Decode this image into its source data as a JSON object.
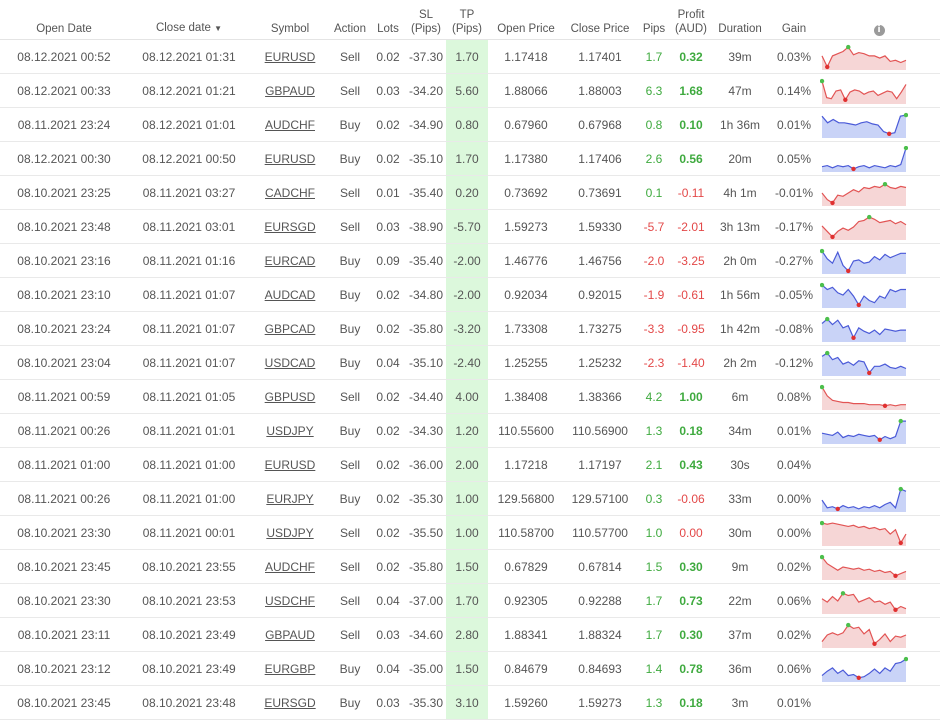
{
  "headers": {
    "open_date": "Open Date",
    "close_date": "Close date",
    "sort_arrow": "▼",
    "symbol": "Symbol",
    "action": "Action",
    "lots": "Lots",
    "sl_1": "SL",
    "sl_2": "(Pips)",
    "tp_1": "TP",
    "tp_2": "(Pips)",
    "open_price": "Open Price",
    "close_price": "Close Price",
    "pips": "Pips",
    "profit_1": "Profit",
    "profit_2": "(AUD)",
    "duration": "Duration",
    "gain": "Gain",
    "info_icon": "info-icon"
  },
  "colors": {
    "positive": "#3faa3f",
    "negative": "#e34848",
    "tp_bg": "#dcf8dc",
    "buy_line": "#4a5ad8",
    "buy_fill": "#c9d3f7",
    "sell_line": "#e25454",
    "sell_fill": "#f6d6d6"
  },
  "trades": [
    {
      "open": "08.12.2021 00:52",
      "close": "08.12.2021 01:31",
      "symbol": "EURUSD",
      "action": "Sell",
      "lots": "0.02",
      "sl": "-37.30",
      "tp": "1.70",
      "open_price": "1.17418",
      "close_price": "1.17401",
      "pips": "1.7",
      "profit": "0.32",
      "duration": "39m",
      "gain": "0.03%",
      "spark": [
        0.55,
        0.05,
        0.55,
        0.65,
        0.75,
        0.95,
        0.6,
        0.7,
        0.65,
        0.55,
        0.55,
        0.45,
        0.55,
        0.3,
        0.35,
        0.25,
        0.35
      ]
    },
    {
      "open": "08.12.2021 00:33",
      "close": "08.12.2021 01:21",
      "symbol": "GBPAUD",
      "action": "Sell",
      "lots": "0.03",
      "sl": "-34.20",
      "tp": "5.60",
      "open_price": "1.88066",
      "close_price": "1.88003",
      "pips": "6.3",
      "profit": "1.68",
      "duration": "47m",
      "gain": "0.14%",
      "spark": [
        0.95,
        0.2,
        0.15,
        0.5,
        0.55,
        0.1,
        0.45,
        0.55,
        0.5,
        0.35,
        0.45,
        0.5,
        0.3,
        0.4,
        0.5,
        0.45,
        0.15,
        0.45,
        0.8
      ]
    },
    {
      "open": "08.11.2021 23:24",
      "close": "08.12.2021 01:01",
      "symbol": "AUDCHF",
      "action": "Buy",
      "lots": "0.02",
      "sl": "-34.90",
      "tp": "0.80",
      "open_price": "0.67960",
      "close_price": "0.67968",
      "pips": "0.8",
      "profit": "0.10",
      "duration": "1h 36m",
      "gain": "0.01%",
      "spark": [
        0.9,
        0.6,
        0.75,
        0.6,
        0.6,
        0.55,
        0.5,
        0.6,
        0.65,
        0.55,
        0.5,
        0.2,
        0.1,
        0.15,
        0.9,
        0.95
      ]
    },
    {
      "open": "08.12.2021 00:30",
      "close": "08.12.2021 00:50",
      "symbol": "EURUSD",
      "action": "Buy",
      "lots": "0.02",
      "sl": "-35.10",
      "tp": "1.70",
      "open_price": "1.17380",
      "close_price": "1.17406",
      "pips": "2.6",
      "profit": "0.56",
      "duration": "20m",
      "gain": "0.05%",
      "spark": [
        0.15,
        0.2,
        0.1,
        0.2,
        0.15,
        0.2,
        0.05,
        0.15,
        0.2,
        0.1,
        0.2,
        0.15,
        0.1,
        0.2,
        0.15,
        0.25,
        1.0
      ]
    },
    {
      "open": "08.10.2021 23:25",
      "close": "08.11.2021 03:27",
      "symbol": "CADCHF",
      "action": "Sell",
      "lots": "0.01",
      "sl": "-35.40",
      "tp": "0.20",
      "open_price": "0.73692",
      "close_price": "0.73691",
      "pips": "0.1",
      "profit": "-0.11",
      "duration": "4h 1m",
      "gain": "-0.01%",
      "spark": [
        0.5,
        0.2,
        0.05,
        0.4,
        0.35,
        0.5,
        0.65,
        0.55,
        0.75,
        0.7,
        0.8,
        0.75,
        0.9,
        0.75,
        0.7,
        0.8,
        0.75
      ]
    },
    {
      "open": "08.10.2021 23:48",
      "close": "08.11.2021 03:01",
      "symbol": "EURSGD",
      "action": "Sell",
      "lots": "0.03",
      "sl": "-38.90",
      "tp": "-5.70",
      "open_price": "1.59273",
      "close_price": "1.59330",
      "pips": "-5.7",
      "profit": "-2.01",
      "duration": "3h 13m",
      "gain": "-0.17%",
      "spark": [
        0.55,
        0.3,
        0.05,
        0.3,
        0.45,
        0.35,
        0.5,
        0.75,
        0.8,
        0.95,
        0.85,
        0.7,
        0.75,
        0.8,
        0.65,
        0.75,
        0.6
      ]
    },
    {
      "open": "08.10.2021 23:16",
      "close": "08.11.2021 01:16",
      "symbol": "EURCAD",
      "action": "Buy",
      "lots": "0.09",
      "sl": "-35.40",
      "tp": "-2.00",
      "open_price": "1.46776",
      "close_price": "1.46756",
      "pips": "-2.0",
      "profit": "-3.25",
      "duration": "2h 0m",
      "gain": "-0.27%",
      "spark": [
        0.95,
        0.6,
        0.4,
        0.9,
        0.3,
        0.05,
        0.5,
        0.55,
        0.4,
        0.45,
        0.7,
        0.55,
        0.8,
        0.65,
        0.75,
        0.85,
        0.85
      ]
    },
    {
      "open": "08.10.2021 23:10",
      "close": "08.11.2021 01:07",
      "symbol": "AUDCAD",
      "action": "Buy",
      "lots": "0.02",
      "sl": "-34.80",
      "tp": "-2.00",
      "open_price": "0.92034",
      "close_price": "0.92015",
      "pips": "-1.9",
      "profit": "-0.61",
      "duration": "1h 56m",
      "gain": "-0.05%",
      "spark": [
        0.95,
        0.75,
        0.85,
        0.6,
        0.5,
        0.75,
        0.45,
        0.05,
        0.45,
        0.25,
        0.15,
        0.45,
        0.35,
        0.75,
        0.65,
        0.75,
        0.75
      ]
    },
    {
      "open": "08.10.2021 23:24",
      "close": "08.11.2021 01:07",
      "symbol": "GBPCAD",
      "action": "Buy",
      "lots": "0.02",
      "sl": "-35.80",
      "tp": "-3.20",
      "open_price": "1.73308",
      "close_price": "1.73275",
      "pips": "-3.3",
      "profit": "-0.95",
      "duration": "1h 42m",
      "gain": "-0.08%",
      "spark": [
        0.75,
        0.95,
        0.7,
        0.9,
        0.55,
        0.65,
        0.1,
        0.55,
        0.4,
        0.3,
        0.45,
        0.25,
        0.5,
        0.45,
        0.4,
        0.45,
        0.45
      ]
    },
    {
      "open": "08.10.2021 23:04",
      "close": "08.11.2021 01:07",
      "symbol": "USDCAD",
      "action": "Buy",
      "lots": "0.04",
      "sl": "-35.10",
      "tp": "-2.40",
      "open_price": "1.25255",
      "close_price": "1.25232",
      "pips": "-2.3",
      "profit": "-1.40",
      "duration": "2h 2m",
      "gain": "-0.12%",
      "spark": [
        0.8,
        0.95,
        0.65,
        0.75,
        0.45,
        0.55,
        0.4,
        0.6,
        0.55,
        0.05,
        0.35,
        0.35,
        0.45,
        0.3,
        0.25,
        0.35,
        0.25
      ]
    },
    {
      "open": "08.11.2021 00:59",
      "close": "08.11.2021 01:05",
      "symbol": "GBPUSD",
      "action": "Sell",
      "lots": "0.02",
      "sl": "-34.40",
      "tp": "4.00",
      "open_price": "1.38408",
      "close_price": "1.38366",
      "pips": "4.2",
      "profit": "1.00",
      "duration": "6m",
      "gain": "0.08%",
      "spark": [
        0.95,
        0.55,
        0.35,
        0.3,
        0.25,
        0.25,
        0.2,
        0.2,
        0.2,
        0.15,
        0.15,
        0.15,
        0.1,
        0.15,
        0.1,
        0.15,
        0.15
      ]
    },
    {
      "open": "08.11.2021 00:26",
      "close": "08.11.2021 01:01",
      "symbol": "USDJPY",
      "action": "Buy",
      "lots": "0.02",
      "sl": "-34.30",
      "tp": "1.20",
      "open_price": "110.55600",
      "close_price": "110.56900",
      "pips": "1.3",
      "profit": "0.18",
      "duration": "34m",
      "gain": "0.01%",
      "spark": [
        0.4,
        0.35,
        0.3,
        0.45,
        0.2,
        0.3,
        0.25,
        0.35,
        0.3,
        0.25,
        0.3,
        0.1,
        0.25,
        0.15,
        0.25,
        0.95,
        0.95
      ]
    },
    {
      "open": "08.11.2021 01:00",
      "close": "08.11.2021 01:00",
      "symbol": "EURUSD",
      "action": "Sell",
      "lots": "0.02",
      "sl": "-36.00",
      "tp": "2.00",
      "open_price": "1.17218",
      "close_price": "1.17197",
      "pips": "2.1",
      "profit": "0.43",
      "duration": "30s",
      "gain": "0.04%",
      "spark": []
    },
    {
      "open": "08.11.2021 00:26",
      "close": "08.11.2021 01:00",
      "symbol": "EURJPY",
      "action": "Buy",
      "lots": "0.02",
      "sl": "-35.30",
      "tp": "1.00",
      "open_price": "129.56800",
      "close_price": "129.57100",
      "pips": "0.3",
      "profit": "-0.06",
      "duration": "33m",
      "gain": "0.00%",
      "spark": [
        0.45,
        0.1,
        0.15,
        0.05,
        0.2,
        0.1,
        0.15,
        0.05,
        0.15,
        0.1,
        0.2,
        0.1,
        0.25,
        0.35,
        0.1,
        0.95,
        0.85
      ]
    },
    {
      "open": "08.10.2021 23:30",
      "close": "08.11.2021 00:01",
      "symbol": "USDJPY",
      "action": "Sell",
      "lots": "0.02",
      "sl": "-35.50",
      "tp": "1.00",
      "open_price": "110.58700",
      "close_price": "110.57700",
      "pips": "1.0",
      "profit": "0.00",
      "duration": "30m",
      "gain": "0.00%",
      "spark": [
        0.95,
        0.9,
        0.95,
        0.9,
        0.85,
        0.8,
        0.85,
        0.75,
        0.8,
        0.7,
        0.75,
        0.65,
        0.7,
        0.45,
        0.65,
        0.05,
        0.45
      ]
    },
    {
      "open": "08.10.2021 23:45",
      "close": "08.10.2021 23:55",
      "symbol": "AUDCHF",
      "action": "Sell",
      "lots": "0.02",
      "sl": "-35.80",
      "tp": "1.50",
      "open_price": "0.67829",
      "close_price": "0.67814",
      "pips": "1.5",
      "profit": "0.30",
      "duration": "9m",
      "gain": "0.02%",
      "spark": [
        0.95,
        0.65,
        0.5,
        0.35,
        0.5,
        0.45,
        0.4,
        0.45,
        0.35,
        0.4,
        0.3,
        0.35,
        0.25,
        0.3,
        0.1,
        0.2,
        0.3
      ]
    },
    {
      "open": "08.10.2021 23:30",
      "close": "08.10.2021 23:53",
      "symbol": "USDCHF",
      "action": "Sell",
      "lots": "0.04",
      "sl": "-37.00",
      "tp": "1.70",
      "open_price": "0.92305",
      "close_price": "0.92288",
      "pips": "1.7",
      "profit": "0.73",
      "duration": "22m",
      "gain": "0.06%",
      "spark": [
        0.6,
        0.45,
        0.7,
        0.5,
        0.85,
        0.75,
        0.8,
        0.45,
        0.55,
        0.65,
        0.45,
        0.5,
        0.35,
        0.45,
        0.1,
        0.25,
        0.15
      ]
    },
    {
      "open": "08.10.2021 23:11",
      "close": "08.10.2021 23:49",
      "symbol": "GBPAUD",
      "action": "Sell",
      "lots": "0.03",
      "sl": "-34.60",
      "tp": "2.80",
      "open_price": "1.88341",
      "close_price": "1.88324",
      "pips": "1.7",
      "profit": "0.30",
      "duration": "37m",
      "gain": "0.02%",
      "spark": [
        0.2,
        0.5,
        0.6,
        0.5,
        0.6,
        0.95,
        0.8,
        0.85,
        0.55,
        0.75,
        0.1,
        0.3,
        0.55,
        0.2,
        0.45,
        0.4,
        0.5
      ]
    },
    {
      "open": "08.10.2021 23:12",
      "close": "08.10.2021 23:49",
      "symbol": "EURGBP",
      "action": "Buy",
      "lots": "0.04",
      "sl": "-35.00",
      "tp": "1.50",
      "open_price": "0.84679",
      "close_price": "0.84693",
      "pips": "1.4",
      "profit": "0.78",
      "duration": "36m",
      "gain": "0.06%",
      "spark": [
        0.2,
        0.4,
        0.55,
        0.3,
        0.45,
        0.2,
        0.25,
        0.1,
        0.15,
        0.3,
        0.5,
        0.3,
        0.55,
        0.4,
        0.75,
        0.8,
        0.95
      ]
    },
    {
      "open": "08.10.2021 23:45",
      "close": "08.10.2021 23:48",
      "symbol": "EURSGD",
      "action": "Buy",
      "lots": "0.03",
      "sl": "-35.30",
      "tp": "3.10",
      "open_price": "1.59260",
      "close_price": "1.59273",
      "pips": "1.3",
      "profit": "0.18",
      "duration": "3m",
      "gain": "0.01%",
      "spark": []
    }
  ]
}
